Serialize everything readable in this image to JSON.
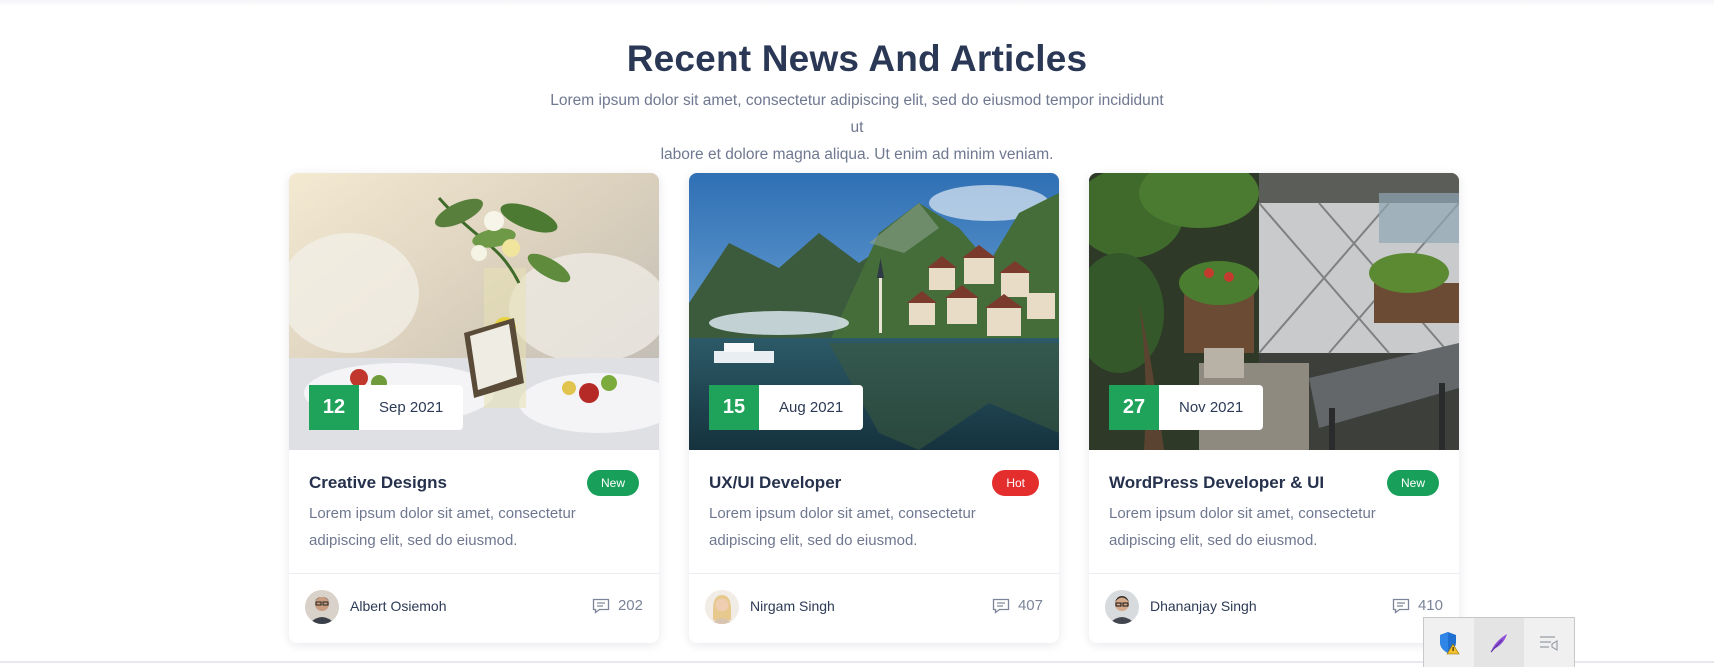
{
  "section": {
    "title": "Recent News And Articles",
    "subtitle_line1": "Lorem ipsum dolor sit amet, consectetur adipiscing elit, sed do eiusmod tempor incididunt ut",
    "subtitle_line2": "labore et dolore magna aliqua. Ut enim ad minim veniam."
  },
  "cards": [
    {
      "day": "12",
      "month": "Sep 2021",
      "title": "Creative Designs",
      "badge": "New",
      "text_line1": "Lorem ipsum dolor sit amet, consectetur",
      "text_line2": "adipiscing elit, sed do eiusmod.",
      "author": "Albert Osiemoh",
      "comments": "202"
    },
    {
      "day": "15",
      "month": "Aug 2021",
      "title": "UX/UI Developer",
      "badge": "Hot",
      "text_line1": "Lorem ipsum dolor sit amet, consectetur",
      "text_line2": "adipiscing elit, sed do eiusmod.",
      "author": "Nirgam Singh",
      "comments": "407"
    },
    {
      "day": "27",
      "month": "Nov 2021",
      "title": "WordPress Developer & UI",
      "badge": "New",
      "text_line1": "Lorem ipsum dolor sit amet, consectetur",
      "text_line2": "adipiscing elit, sed do eiusmod.",
      "author": "Dhananjay Singh",
      "comments": "410"
    }
  ],
  "colors": {
    "accent_green": "#1fa25a",
    "badge_new": "#18a05a",
    "badge_hot": "#e42d2d",
    "heading": "#2a3755",
    "body_text": "#6f7890"
  },
  "icons": {
    "comment": "comment-icon",
    "tray": [
      "shield-warning-icon",
      "feather-icon",
      "notification-icon"
    ]
  }
}
